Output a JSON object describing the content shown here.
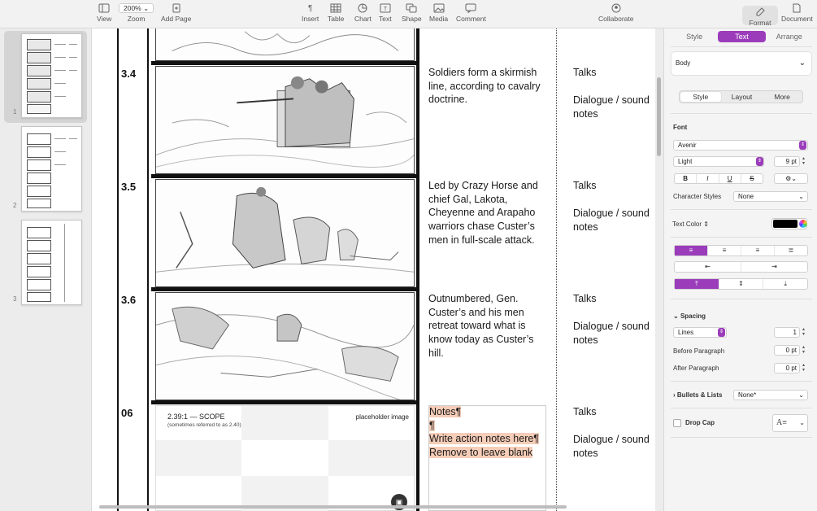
{
  "toolbar": {
    "view": "View",
    "zoom_value": "200%",
    "zoom": "Zoom",
    "add_page": "Add Page",
    "insert": "Insert",
    "table": "Table",
    "chart": "Chart",
    "text": "Text",
    "shape": "Shape",
    "media": "Media",
    "comment": "Comment",
    "collaborate": "Collaborate",
    "format": "Format",
    "document": "Document"
  },
  "thumbnails": [
    {
      "num": "1",
      "selected": true
    },
    {
      "num": "2",
      "selected": false
    },
    {
      "num": "3",
      "selected": false
    }
  ],
  "scenes": [
    {
      "num": "3.4",
      "desc": "Soldiers form a skirmish line, according to cavalry doctrine.",
      "talks": "Talks",
      "dialogue": "Dialogue / sound notes"
    },
    {
      "num": "3.5",
      "desc": "Led by Crazy Horse and chief Gal, Lakota, Cheyenne and Arapaho warriors chase Custer’s men in full-scale attack.",
      "talks": "Talks",
      "dialogue": "Dialogue / sound notes"
    },
    {
      "num": "3.6",
      "desc": "Outnumbered, Gen. Custer’s and his men retreat toward what is know today as Custer’s hill.",
      "talks": "Talks",
      "dialogue": "Dialogue / sound notes"
    },
    {
      "num": "06",
      "talks": "Talks",
      "dialogue": "Dialogue / sound notes"
    }
  ],
  "placeholder": {
    "title": "2.39:1 — SCOPE",
    "subtitle": "(sometimes referred to as 2.40)",
    "label": "placeholder image"
  },
  "notes": {
    "line1": "Notes¶",
    "line2": "¶",
    "line3": "Write action notes here¶",
    "line4": "Remove to leave blank"
  },
  "inspector": {
    "tabs": [
      "Style",
      "Text",
      "Arrange"
    ],
    "active_tab": "Text",
    "paragraph_style": "Body",
    "sub_tabs": [
      "Style",
      "Layout",
      "More"
    ],
    "active_sub_tab": "Style",
    "font_heading": "Font",
    "font_name": "Avenir",
    "font_weight": "Light",
    "font_size": "9 pt",
    "style_buttons": [
      "B",
      "I",
      "U",
      "S"
    ],
    "character_styles_label": "Character Styles",
    "character_styles_value": "None",
    "text_color_label": "Text Color",
    "text_color": "#000000",
    "accent_color": "#9b3dbb",
    "spacing_heading": "Spacing",
    "spacing_mode": "Lines",
    "spacing_value": "1",
    "before_paragraph_label": "Before Paragraph",
    "before_paragraph_value": "0 pt",
    "after_paragraph_label": "After Paragraph",
    "after_paragraph_value": "0 pt",
    "bullets_label": "Bullets & Lists",
    "bullets_value": "None*",
    "drop_cap_label": "Drop Cap"
  }
}
